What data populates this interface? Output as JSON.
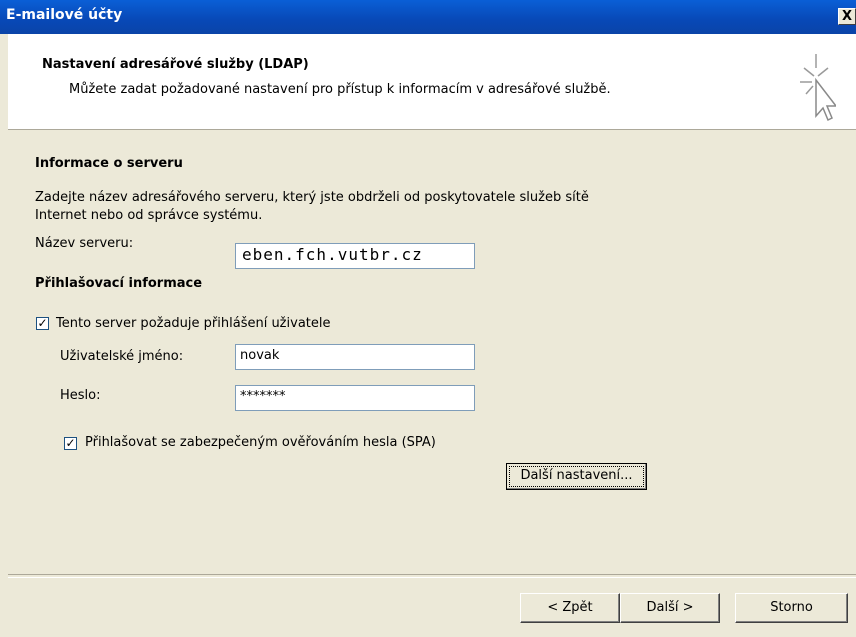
{
  "window": {
    "title": "E-mailové účty",
    "close_glyph": "X"
  },
  "header": {
    "title": "Nastavení adresářové služby (LDAP)",
    "subtitle": "Můžete zadat požadované nastavení pro přístup k informacím v adresářové službě."
  },
  "server_info": {
    "heading": "Informace o serveru",
    "description_line1": "Zadejte název adresářového serveru, který jste obdrželi od poskytovatele služeb sítě",
    "description_line2": "Internet nebo od správce systému.",
    "server_name_label": "Název serveru:",
    "server_name_value": "eben.fch.vutbr.cz"
  },
  "login_info": {
    "heading": "Přihlašovací informace",
    "requires_login_label": "Tento server požaduje přihlášení uživatele",
    "requires_login_checked": true,
    "username_label": "Uživatelské jméno:",
    "username_value": "novak",
    "password_label": "Heslo:",
    "password_value": "*******",
    "spa_label": "Přihlašovat se zabezpečeným ověřováním hesla (SPA)",
    "spa_checked": true,
    "more_settings_button": "Další nastavení..."
  },
  "footer": {
    "back_button": "< Zpět",
    "next_button": "Další >",
    "cancel_button": "Storno"
  }
}
